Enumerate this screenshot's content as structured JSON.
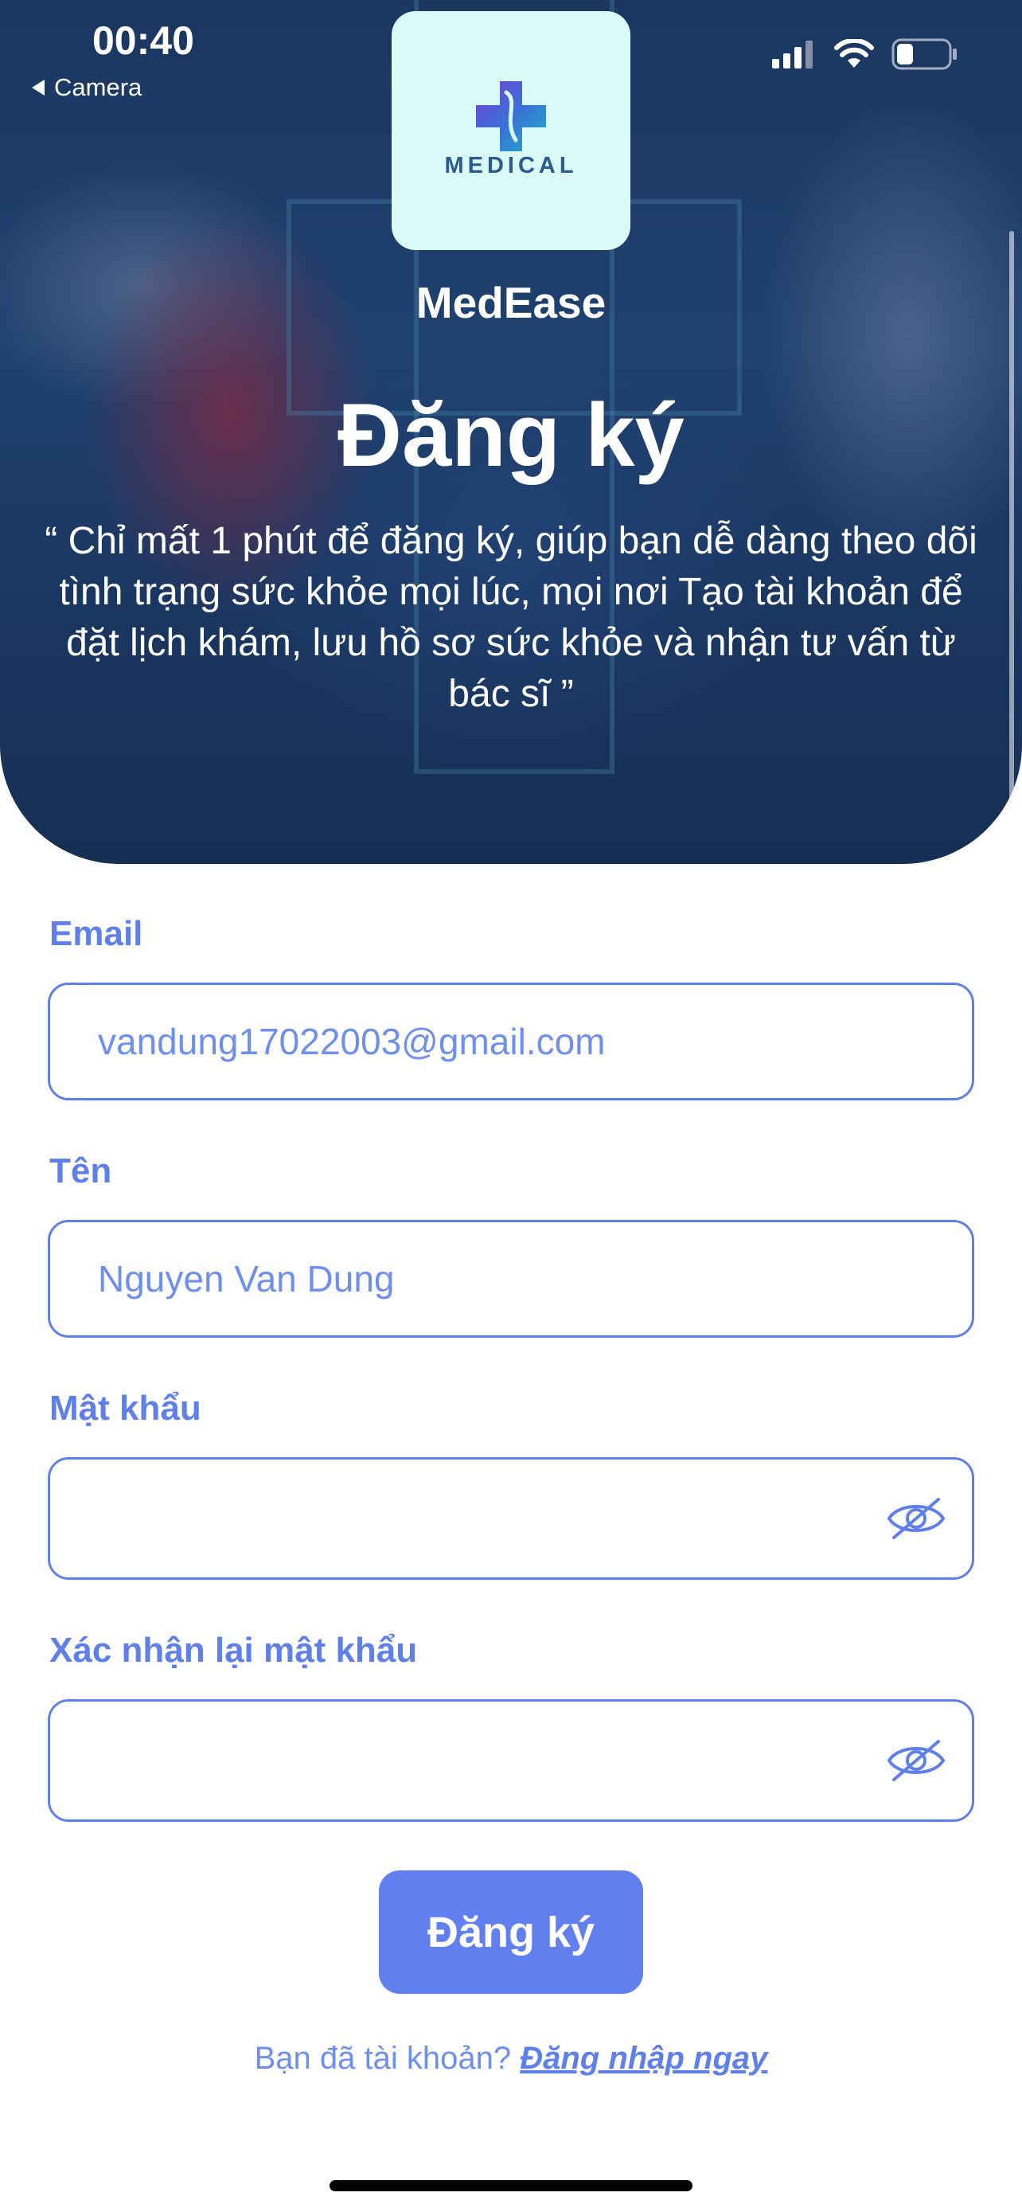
{
  "status_bar": {
    "time": "00:40",
    "back_label": "Camera"
  },
  "header": {
    "logo_text": "MEDICAL",
    "app_name": "MedEase",
    "title": "Đăng ký",
    "tagline": "“ Chỉ mất 1 phút để đăng ký, giúp bạn dễ dàng theo dõi tình trạng sức khỏe mọi lúc, mọi nơi Tạo tài khoản để đặt lịch khám, lưu hồ sơ sức khỏe và nhận tư vấn từ bác sĩ ”"
  },
  "form": {
    "email": {
      "label": "Email",
      "value": "vandung17022003@gmail.com"
    },
    "name": {
      "label": "Tên",
      "value": "Nguyen Van Dung"
    },
    "password": {
      "label": "Mật khẩu",
      "value": ""
    },
    "confirm_password": {
      "label": "Xác nhận lại mật khẩu",
      "value": ""
    },
    "submit_label": "Đăng ký"
  },
  "footer": {
    "prompt": "Bạn đã tài khoản?",
    "login_link": "Đăng nhập ngay"
  },
  "colors": {
    "accent": "#5f80ea",
    "button": "#627ff0",
    "logo_bg": "#dafaf7"
  },
  "icons": {
    "password_toggle": "eye-slash-icon",
    "logo": "medical-cross-icon"
  }
}
